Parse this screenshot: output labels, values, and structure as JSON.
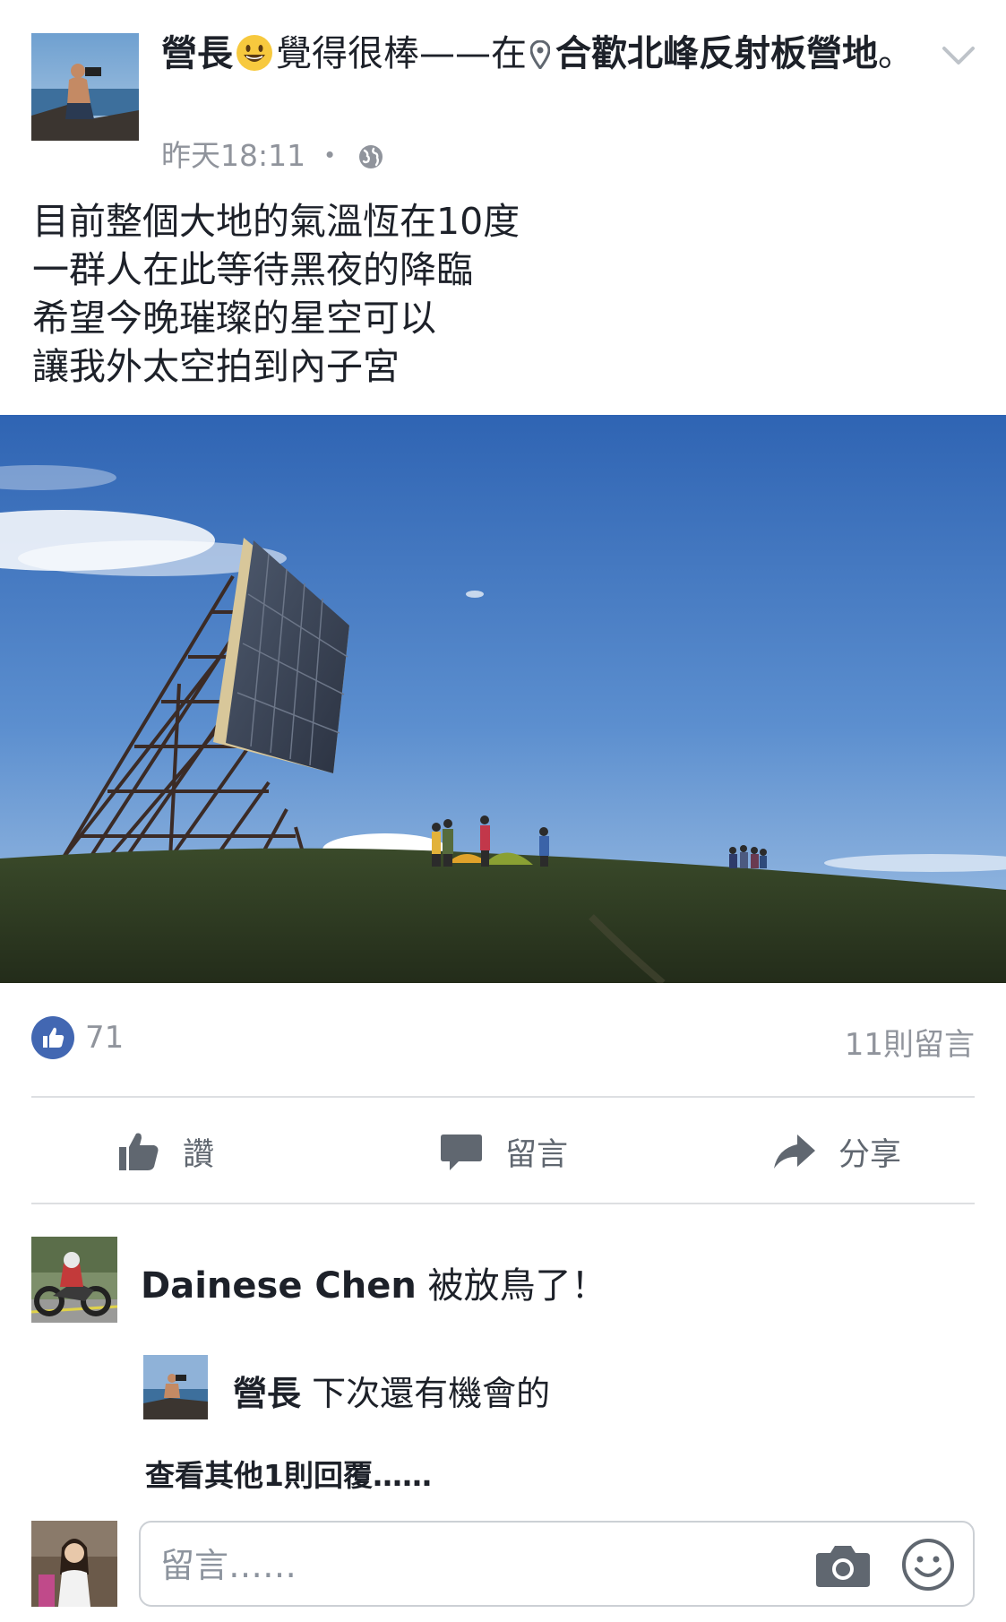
{
  "post": {
    "author": "營長",
    "feeling": "覺得很棒——在",
    "location": "合歡北峰反射板營地",
    "location_suffix": "。",
    "time": "昨天18:11",
    "separator": "・",
    "body_lines": [
      "目前整個大地的氣溫恆在10度",
      "一群人在此等待黑夜的降臨",
      "希望今晚璀璨的星空可以",
      "讓我外太空拍到內子宮"
    ]
  },
  "stats": {
    "like_count": "71",
    "comment_count": "11則留言"
  },
  "actions": {
    "like": "讚",
    "comment": "留言",
    "share": "分享"
  },
  "comments": [
    {
      "name": "Dainese Chen",
      "text": "被放鳥了！"
    },
    {
      "name": "營長",
      "text": "下次還有機會的"
    }
  ],
  "more_replies": "查看其他1則回覆……",
  "composer": {
    "placeholder": "留言……"
  },
  "icons": {
    "emoji": "grinning-face-icon",
    "location": "map-pin-icon",
    "privacy": "globe-icon",
    "menu": "chevron-down-icon",
    "like": "thumbs-up-icon",
    "comment": "speech-bubble-icon",
    "share": "share-arrow-icon",
    "camera": "camera-icon",
    "sticker": "smiley-icon"
  },
  "colors": {
    "brand": "#4267b2",
    "secondary_text": "#90949c",
    "divider": "#dddfe2"
  }
}
